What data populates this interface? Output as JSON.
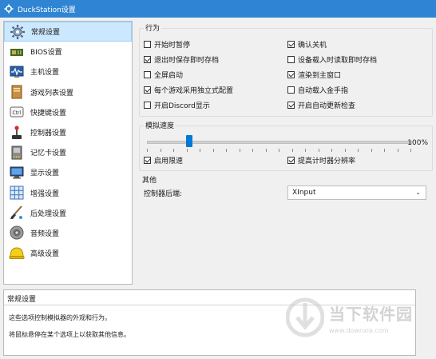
{
  "window": {
    "title": "DuckStation设置"
  },
  "sidebar": {
    "items": [
      {
        "label": "常规设置",
        "icon": "gear-icon",
        "selected": true
      },
      {
        "label": "BIOS设置",
        "icon": "chip-icon"
      },
      {
        "label": "主机设置",
        "icon": "monitor-wave-icon"
      },
      {
        "label": "游戏列表设置",
        "icon": "book-icon"
      },
      {
        "label": "快捷键设置",
        "icon": "keyboard-key-icon"
      },
      {
        "label": "控制器设置",
        "icon": "joystick-icon"
      },
      {
        "label": "记忆卡设置",
        "icon": "memory-card-icon"
      },
      {
        "label": "显示设置",
        "icon": "display-icon"
      },
      {
        "label": "增强设置",
        "icon": "grid-icon"
      },
      {
        "label": "后处理设置",
        "icon": "brush-icon"
      },
      {
        "label": "音频设置",
        "icon": "speaker-icon"
      },
      {
        "label": "高级设置",
        "icon": "helmet-icon"
      }
    ]
  },
  "behavior": {
    "title": "行为",
    "options": [
      {
        "label": "开始时暂停",
        "checked": false
      },
      {
        "label": "确认关机",
        "checked": true
      },
      {
        "label": "退出时保存即时存档",
        "checked": true
      },
      {
        "label": "设备载入时读取即时存档",
        "checked": false
      },
      {
        "label": "全屏启动",
        "checked": false
      },
      {
        "label": "渲染到主窗口",
        "checked": true
      },
      {
        "label": "每个游戏采用独立式配置",
        "checked": true
      },
      {
        "label": "自动载入金手指",
        "checked": false
      },
      {
        "label": "开启Discord显示",
        "checked": false
      },
      {
        "label": "开启自动更新检查",
        "checked": true
      }
    ]
  },
  "speed": {
    "title": "模拟速度",
    "value_label": "100%",
    "slider_fraction": 0.16,
    "options": [
      {
        "label": "启用限速",
        "checked": true
      },
      {
        "label": "提高计时器分辨率",
        "checked": true
      }
    ]
  },
  "other": {
    "title": "其他",
    "controller_label": "控制器后端:",
    "controller_value": "XInput"
  },
  "description": {
    "title": "常规设置",
    "line1": "这些选项控制模拟器的外观和行为。",
    "line2": "将鼠标悬停在某个选项上以获取其他信息。"
  },
  "watermark": {
    "brand": "当下软件园",
    "url": "www.downxia.com"
  },
  "colors": {
    "titlebar": "#2f85d3",
    "selection": "#cce8ff",
    "accent": "#0078d7"
  }
}
